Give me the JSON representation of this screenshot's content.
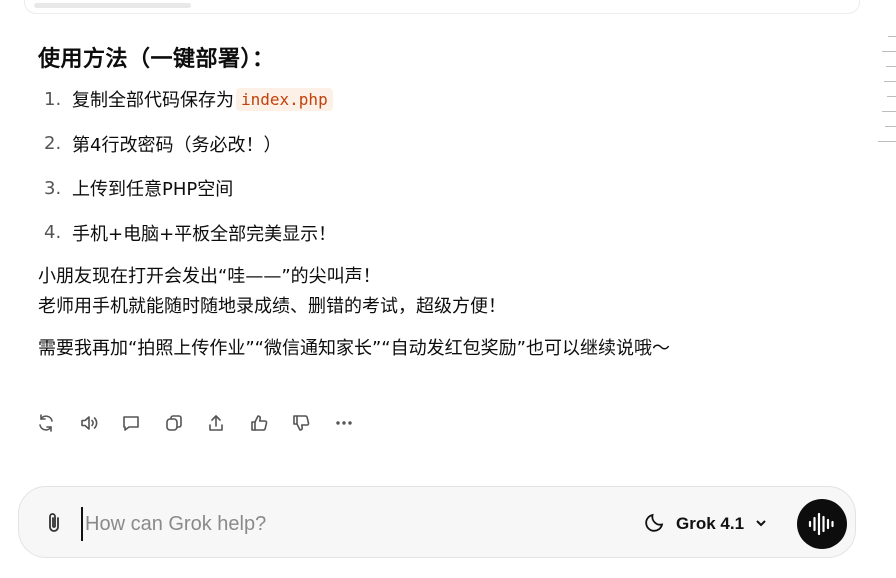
{
  "heading": "使用方法（一键部署）：",
  "steps": [
    {
      "num": "1.",
      "text": "复制全部代码保存为",
      "code": "index.php"
    },
    {
      "num": "2.",
      "text": "第4行改密码（务必改！）"
    },
    {
      "num": "3.",
      "text": "上传到任意PHP空间"
    },
    {
      "num": "4.",
      "text": "手机+电脑+平板全部完美显示！"
    }
  ],
  "paragraphs": [
    "小朋友现在打开会发出“哇——”的尖叫声！",
    "老师用手机就能随时随地录成绩、删错的考试，超级方便！",
    "需要我再加“拍照上传作业”“微信通知家长”“自动发红包奖励”也可以继续说哦～"
  ],
  "actions": [
    "regenerate-icon",
    "read-aloud-icon",
    "comment-icon",
    "copy-icon",
    "share-icon",
    "thumbs-up-icon",
    "thumbs-down-icon",
    "more-icon"
  ],
  "composer": {
    "placeholder": "How can Grok help?",
    "model": "Grok 4.1"
  },
  "colors": {
    "code_text": "#c2410c",
    "code_bg": "#fdf0e6",
    "voice_button": "#0d0d0d"
  }
}
